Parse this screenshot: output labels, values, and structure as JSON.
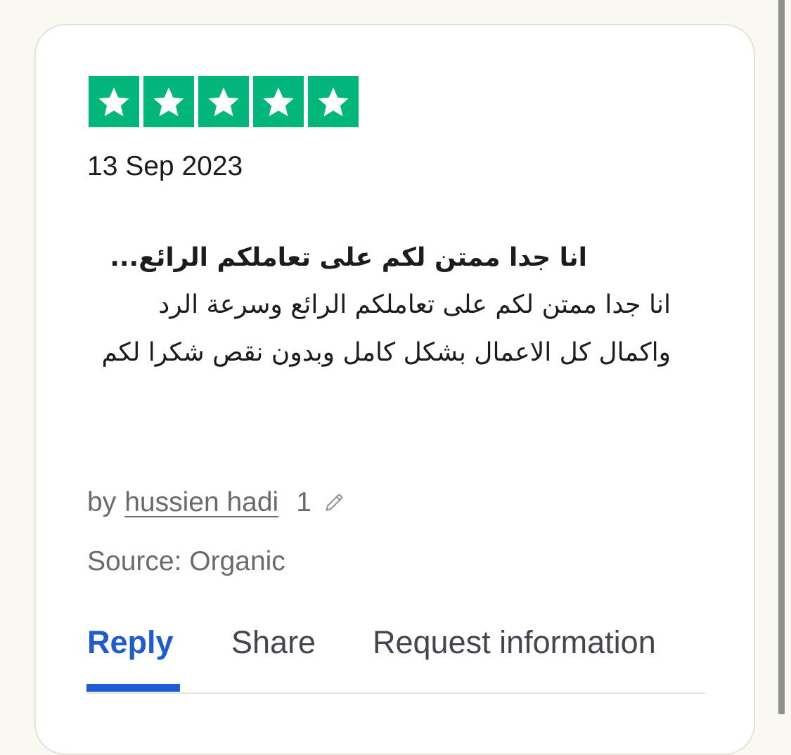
{
  "review": {
    "rating": 5,
    "rating_max": 5,
    "star_color": "#00b67a",
    "date": "13 Sep 2023",
    "title": "انا جدا ممتن لكم على تعاملكم الرائع...",
    "body": "انا جدا ممتن لكم على تعاملكم الرائع وسرعة الرد واكمال كل الاعمال بشكل كامل وبدون نقص شكرا لكم",
    "author_prefix": "by",
    "author_name": "hussien hadi",
    "review_count": "1",
    "edit_icon": "pencil-icon",
    "source": "Source: Organic"
  },
  "tabs": {
    "active_color": "#1f5cd1",
    "items": [
      {
        "label": "Reply",
        "active": true
      },
      {
        "label": "Share",
        "active": false
      },
      {
        "label": "Request information",
        "active": false
      }
    ]
  }
}
